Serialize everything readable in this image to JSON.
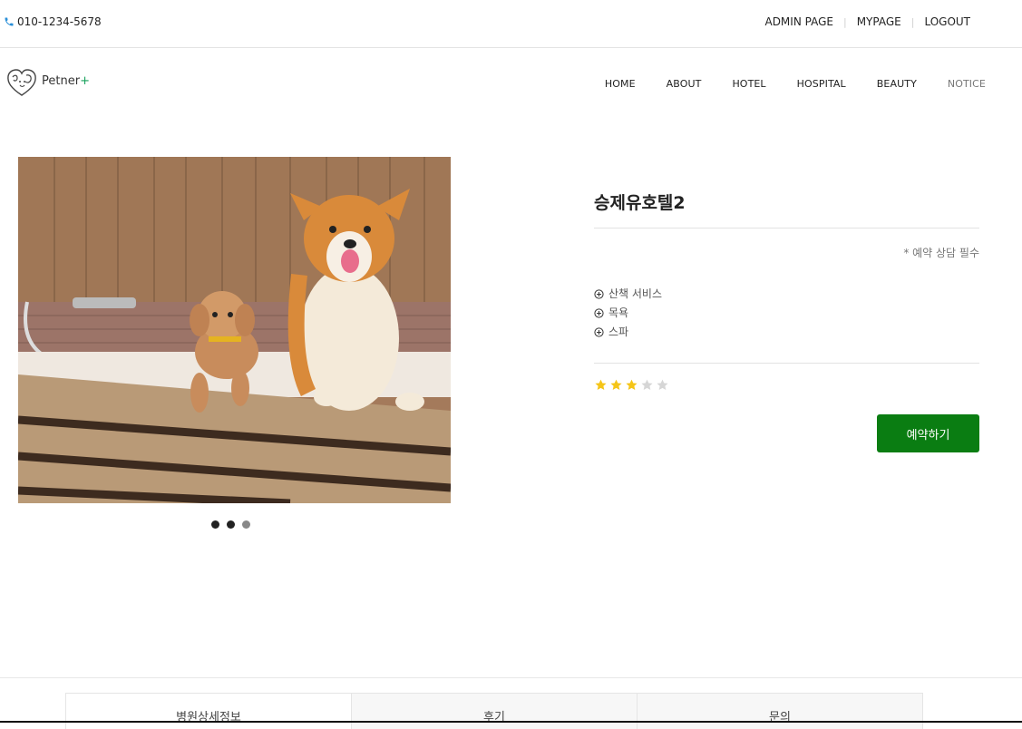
{
  "topbar": {
    "phone": "010-1234-5678",
    "links": [
      "ADMIN PAGE",
      "MYPAGE",
      "LOGOUT"
    ]
  },
  "brand": {
    "name": "Petner",
    "plus": "+"
  },
  "nav": {
    "items": [
      "HOME",
      "ABOUT",
      "HOTEL",
      "HOSPITAL",
      "BEAUTY",
      "NOTICE"
    ]
  },
  "gallery": {
    "image": "photo of a poodle and a corgi in a bathtub",
    "slide_count": 3,
    "active_slide": 1
  },
  "detail": {
    "title": "승제유호텔2",
    "note": "* 예약 상담 필수",
    "services": [
      "산책 서비스",
      "목욕",
      "스파"
    ],
    "rating": 3,
    "rating_max": 5,
    "book_label": "예약하기"
  },
  "tabs": [
    "병원상세정보",
    "후기",
    "문의"
  ],
  "colors": {
    "accent": "#0a7d12",
    "star_on": "#f5c518",
    "star_off": "#d6d6d6",
    "phone_icon": "#2a8fd8"
  },
  "icons": {
    "phone": "phone-icon",
    "service": "plus-circle-icon",
    "star": "star-icon"
  }
}
